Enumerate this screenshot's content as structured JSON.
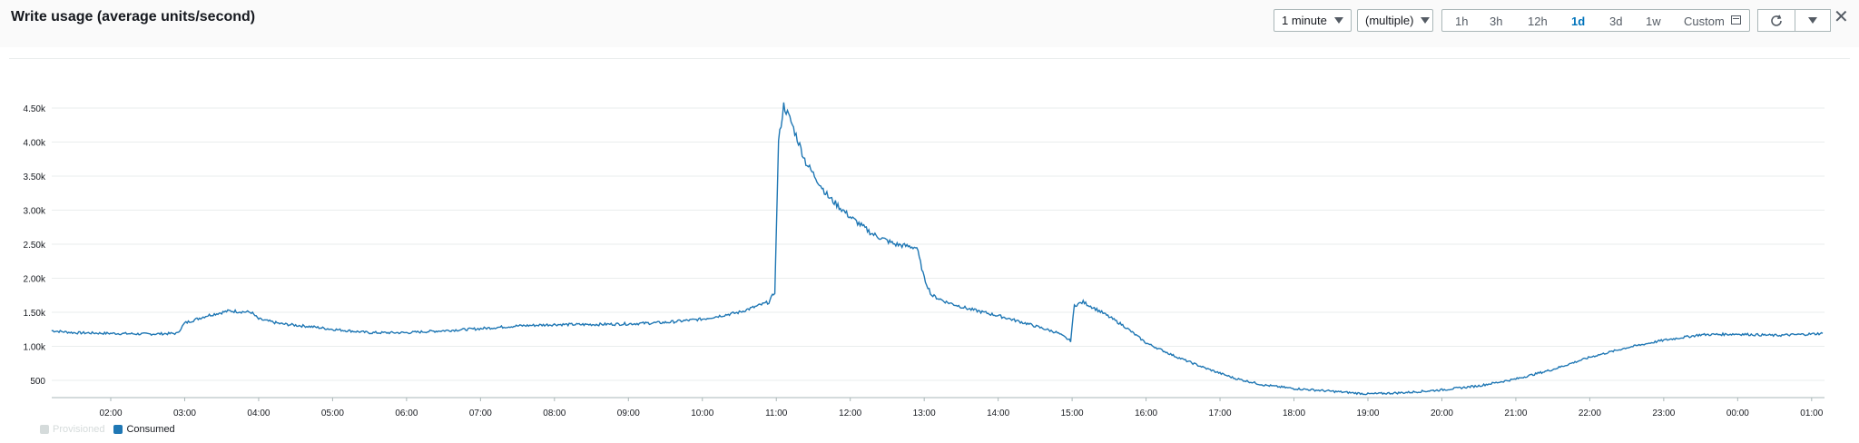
{
  "header": {
    "title": "Write usage (average units/second)",
    "period": "1 minute",
    "statistic": "(multiple)",
    "ranges": [
      "1h",
      "3h",
      "12h",
      "1d",
      "3d",
      "1w"
    ],
    "selected_range": "1d",
    "custom_label": "Custom"
  },
  "icons": {
    "refresh": "refresh-icon",
    "calendar": "calendar-icon",
    "close": "close-icon",
    "dropdown": "chevron-down-icon"
  },
  "colors": {
    "consumed": "#1f77b4",
    "provisioned": "#d5dbdb",
    "selected_range": "#0073bb"
  },
  "legend": [
    {
      "label": "Provisioned",
      "enabled": false
    },
    {
      "label": "Consumed",
      "enabled": true
    }
  ],
  "chart_data": {
    "type": "line",
    "title": "Write usage (average units/second)",
    "xlabel": "",
    "ylabel": "",
    "ylim": [
      300,
      4700
    ],
    "x_tick_labels": [
      "02:00",
      "03:00",
      "04:00",
      "05:00",
      "06:00",
      "07:00",
      "08:00",
      "09:00",
      "10:00",
      "11:00",
      "12:00",
      "13:00",
      "14:00",
      "15:00",
      "16:00",
      "17:00",
      "18:00",
      "19:00",
      "20:00",
      "21:00",
      "22:00",
      "23:00",
      "00:00",
      "01:00"
    ],
    "y_ticks": [
      500,
      1000,
      1500,
      2000,
      2500,
      3000,
      3500,
      4000,
      4500
    ],
    "y_tick_labels": [
      "500",
      "1.00k",
      "1.50k",
      "2.00k",
      "2.50k",
      "3.00k",
      "3.50k",
      "4.00k",
      "4.50k"
    ],
    "grid": true,
    "legend_position": "bottom-left",
    "series": [
      {
        "name": "Consumed",
        "x_hours": [
          1.2,
          1.5,
          2.0,
          2.5,
          2.9,
          3.0,
          3.3,
          3.6,
          3.9,
          4.0,
          4.3,
          4.7,
          5.0,
          5.5,
          6.0,
          6.5,
          7.0,
          7.5,
          8.0,
          8.5,
          9.0,
          9.5,
          10.0,
          10.5,
          10.9,
          10.98,
          11.03,
          11.1,
          11.2,
          11.4,
          11.7,
          12.0,
          12.3,
          12.6,
          12.9,
          13.0,
          13.1,
          13.3,
          13.6,
          14.0,
          14.4,
          14.8,
          14.98,
          15.03,
          15.15,
          15.4,
          15.7,
          16.0,
          16.4,
          16.8,
          17.2,
          17.6,
          18.0,
          18.5,
          19.0,
          19.5,
          20.0,
          20.5,
          21.0,
          21.5,
          22.0,
          22.5,
          23.0,
          23.5,
          24.0,
          24.5,
          25.0,
          25.15
        ],
        "values": [
          1230,
          1200,
          1190,
          1180,
          1190,
          1340,
          1450,
          1520,
          1500,
          1400,
          1330,
          1290,
          1250,
          1200,
          1200,
          1230,
          1260,
          1300,
          1320,
          1320,
          1330,
          1350,
          1400,
          1500,
          1650,
          1800,
          4000,
          4540,
          4300,
          3700,
          3200,
          2900,
          2650,
          2500,
          2450,
          2000,
          1750,
          1650,
          1550,
          1450,
          1330,
          1200,
          1080,
          1600,
          1650,
          1500,
          1300,
          1050,
          850,
          680,
          530,
          430,
          380,
          340,
          300,
          320,
          360,
          420,
          520,
          660,
          840,
          980,
          1090,
          1170,
          1180,
          1160,
          1180,
          1190
        ]
      }
    ]
  }
}
